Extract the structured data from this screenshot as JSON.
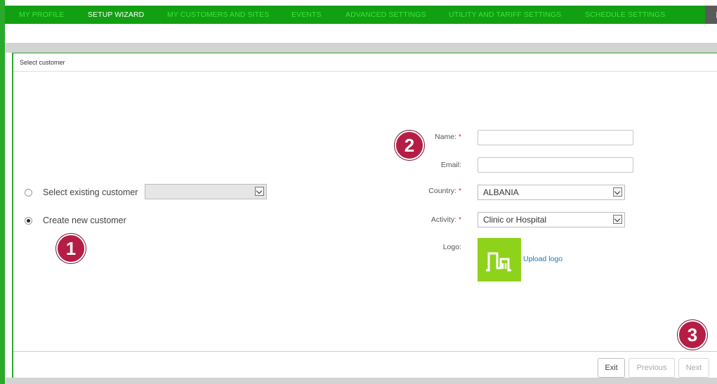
{
  "nav": {
    "items": [
      {
        "label": "MY PROFILE",
        "active": false
      },
      {
        "label": "SETUP WIZARD",
        "active": true
      },
      {
        "label": "MY CUSTOMERS AND SITES",
        "active": false
      },
      {
        "label": "EVENTS",
        "active": false
      },
      {
        "label": "ADVANCED SETTINGS",
        "active": false
      },
      {
        "label": "UTILITY AND TARIFF SETTINGS",
        "active": false
      },
      {
        "label": "SCHEDULE SETTINGS",
        "active": false
      }
    ]
  },
  "panel": {
    "title": "Select customer"
  },
  "customer_choice": {
    "existing_label": "Select existing customer",
    "existing_selected": false,
    "existing_value": "",
    "new_label": "Create new customer",
    "new_selected": true
  },
  "form": {
    "name_label": "Name:",
    "name_value": "",
    "email_label": "Email:",
    "email_value": "",
    "country_label": "Country:",
    "country_value": "ALBANIA",
    "activity_label": "Activity:",
    "activity_value": "Clinic or Hospital",
    "logo_label": "Logo:",
    "upload_label": "Upload logo",
    "required_mark": "*"
  },
  "markers": [
    "1",
    "2",
    "3"
  ],
  "footer": {
    "exit_label": "Exit",
    "previous_label": "Previous",
    "next_label": "Next"
  },
  "colors": {
    "nav_green": "#12a012",
    "accent_green": "#2aa92a",
    "logo_green": "#8fd21b",
    "marker": "#b51d45",
    "link": "#1f78b4"
  }
}
